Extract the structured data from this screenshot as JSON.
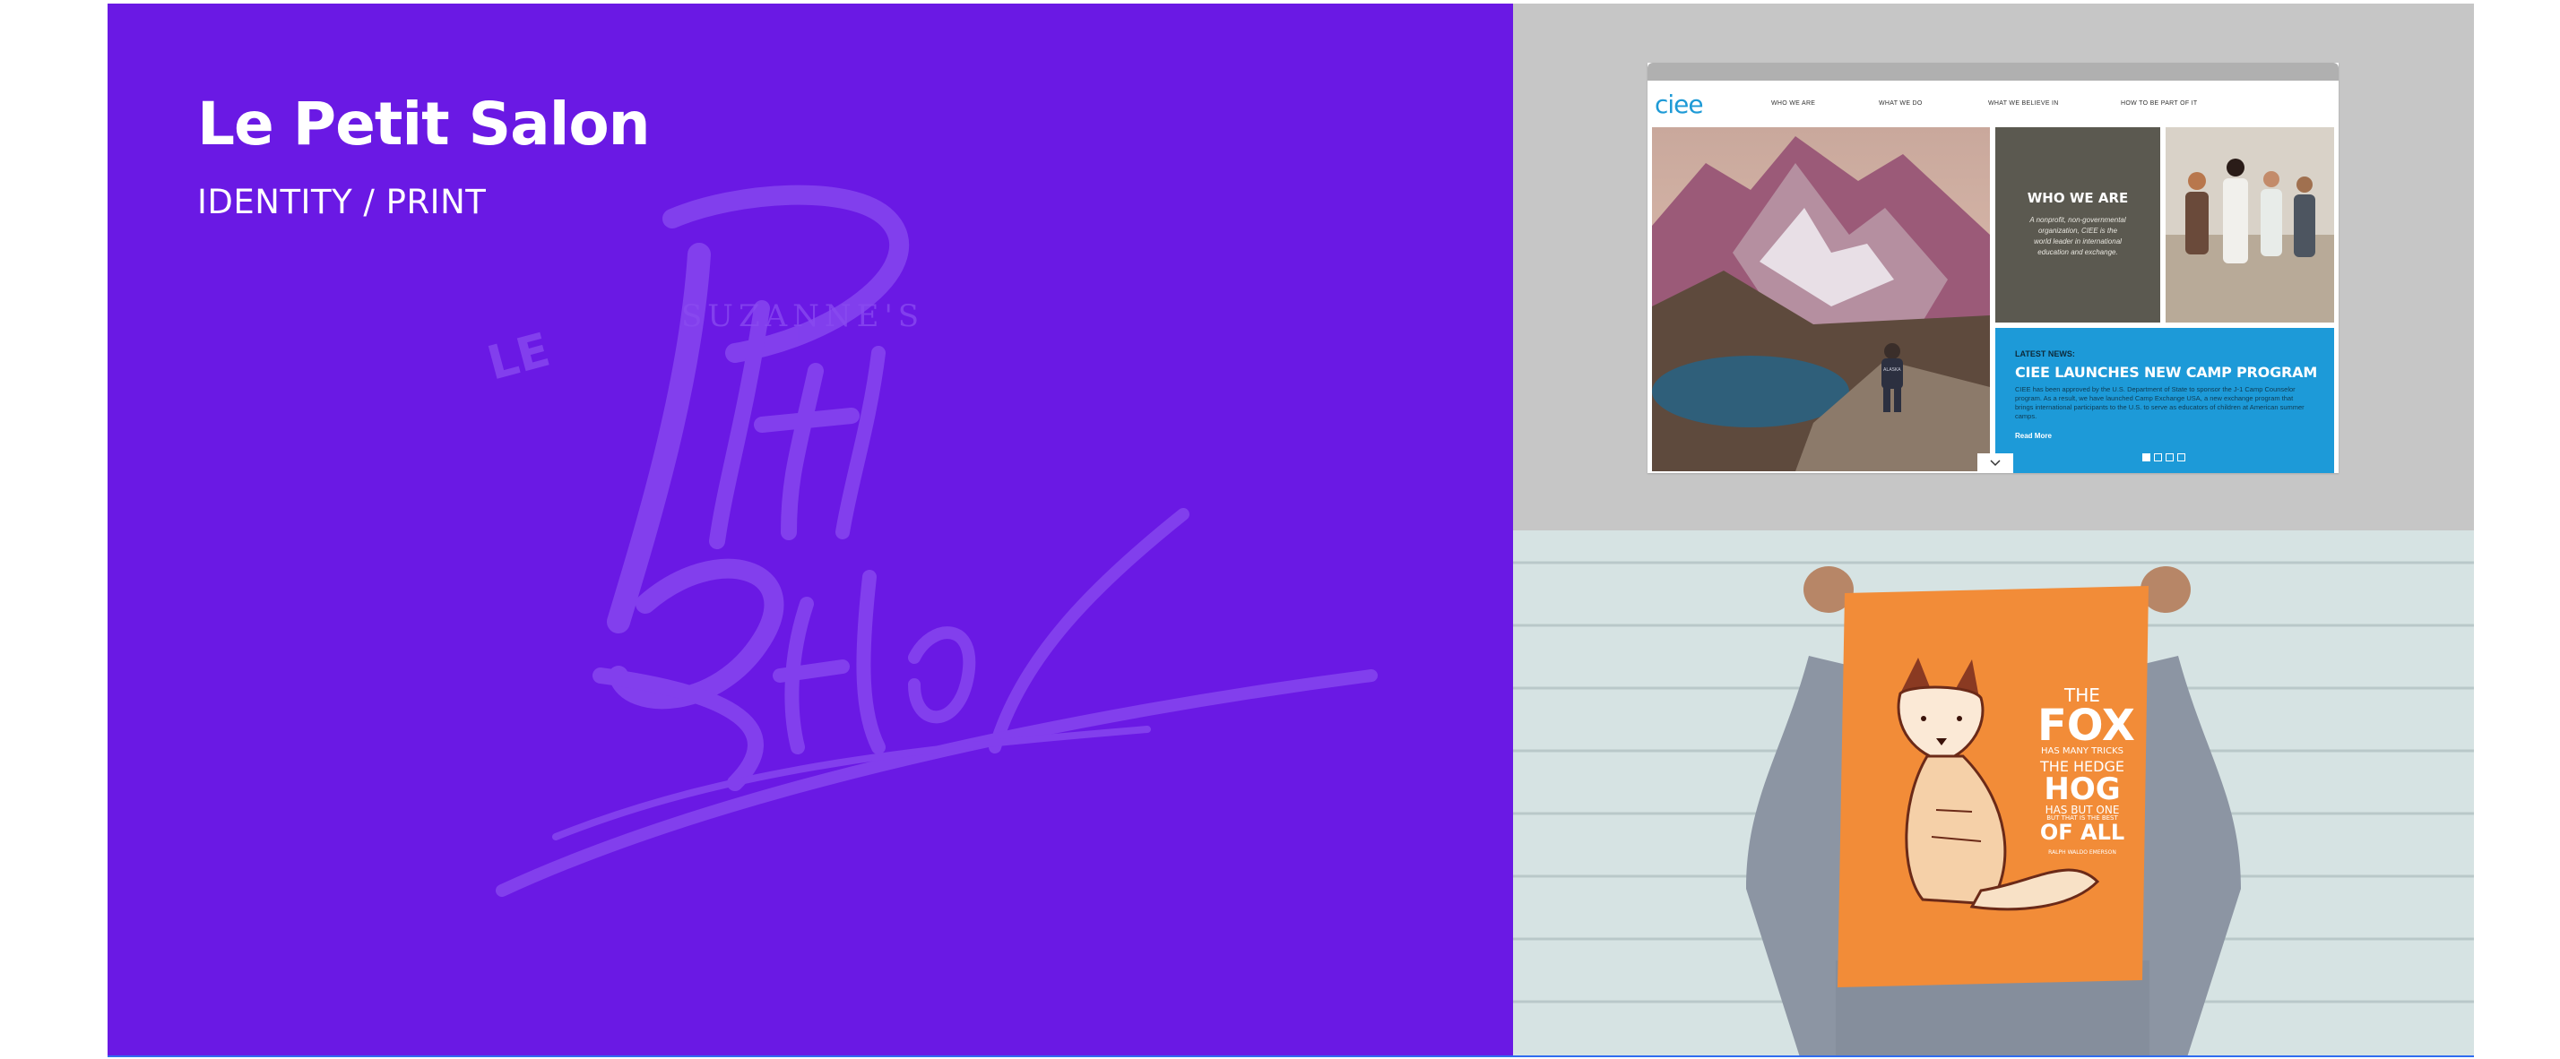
{
  "project": {
    "title": "Le Petit Salon",
    "subtitle": "IDENTITY / PRINT",
    "accent_color": "#6a19e4"
  },
  "logo_mark": {
    "lines": [
      "SUZANNE'S",
      "LE",
      "Petit",
      "SALON"
    ]
  },
  "website_mockup": {
    "site_logo": "ciee",
    "nav": [
      "WHO WE ARE",
      "WHAT WE DO",
      "WHAT WE BELIEVE IN",
      "HOW TO BE PART OF IT"
    ],
    "who_we_are": {
      "title": "WHO WE ARE",
      "text": "A nonprofit, non-governmental organization, CIEE is the world leader in international education and exchange."
    },
    "news": {
      "kicker": "LATEST NEWS:",
      "title": "CIEE LAUNCHES NEW CAMP PROGRAM",
      "body": "CIEE has been approved by the U.S. Department of State to sponsor the J-1 Camp Counselor program. As a result, we have launched Camp Exchange USA, a new exchange program that brings international participants to the U.S. to serve as educators of children at American summer camps.",
      "read_more": "Read More"
    },
    "slider_dots": 4,
    "hero_badge": "ALASKA"
  },
  "poster": {
    "lines": [
      "THE",
      "FOX",
      "HAS MANY TRICKS",
      "THE HEDGE",
      "HOG",
      "HAS BUT ONE",
      "BUT THAT IS THE BEST",
      "OF ALL",
      "RALPH WALDO EMERSON"
    ],
    "color": "#f28c38"
  }
}
